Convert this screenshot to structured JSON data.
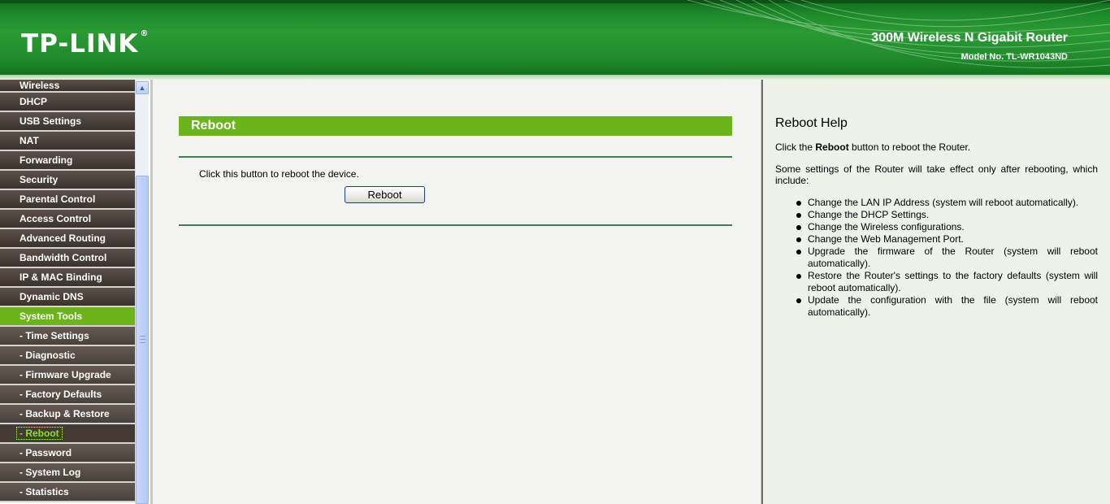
{
  "header": {
    "logo": "TP-LINK",
    "logo_reg": "®",
    "product": "300M Wireless N Gigabit Router",
    "model": "Model No. TL-WR1043ND"
  },
  "sidebar": {
    "items": [
      {
        "label": "Wireless"
      },
      {
        "label": "DHCP"
      },
      {
        "label": "USB Settings"
      },
      {
        "label": "NAT"
      },
      {
        "label": "Forwarding"
      },
      {
        "label": "Security"
      },
      {
        "label": "Parental Control"
      },
      {
        "label": "Access Control"
      },
      {
        "label": "Advanced Routing"
      },
      {
        "label": "Bandwidth Control"
      },
      {
        "label": "IP & MAC Binding"
      },
      {
        "label": "Dynamic DNS"
      },
      {
        "label": "System Tools"
      },
      {
        "label": "- Time Settings"
      },
      {
        "label": "- Diagnostic"
      },
      {
        "label": "- Firmware Upgrade"
      },
      {
        "label": "- Factory Defaults"
      },
      {
        "label": "- Backup & Restore"
      },
      {
        "label": "- Reboot"
      },
      {
        "label": "- Password"
      },
      {
        "label": "- System Log"
      },
      {
        "label": "- Statistics"
      }
    ]
  },
  "main": {
    "title": "Reboot",
    "description": "Click this button to reboot the device.",
    "button_label": "Reboot"
  },
  "help": {
    "title": "Reboot Help",
    "p1_before": "Click the ",
    "p1_bold": "Reboot",
    "p1_after": " button to reboot the Router.",
    "p2": "Some settings of the Router will take effect only after rebooting, which include:",
    "items": [
      "Change the LAN IP Address (system will reboot automatically).",
      "Change the DHCP Settings.",
      "Change the Wireless configurations.",
      "Change the Web Management Port.",
      "Upgrade the firmware of the Router (system will reboot automatically).",
      "Restore the Router's settings to the factory defaults (system will reboot automatically).",
      "Update the configuration with the file (system will reboot automatically)."
    ]
  },
  "colors": {
    "header_green": "#1f8a2b",
    "accent_green": "#6bb51b",
    "nav_dark": "#3a322c",
    "selected_text": "#8fe21d"
  }
}
